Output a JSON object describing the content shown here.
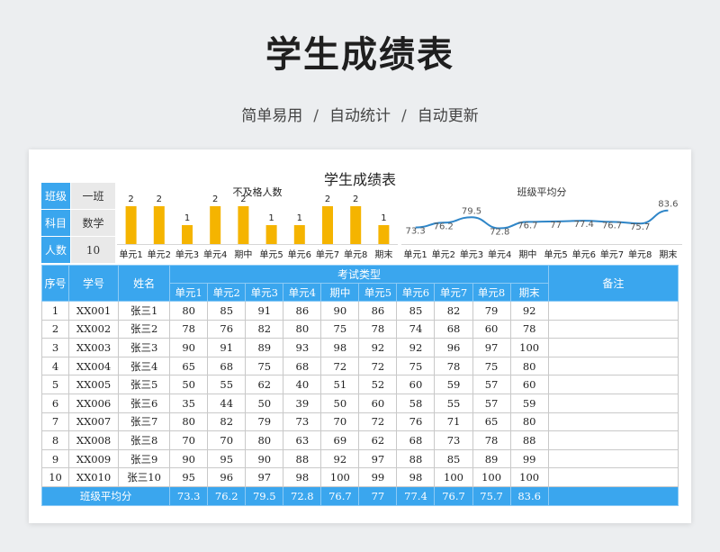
{
  "header": {
    "title": "学生成绩表",
    "subtitle_items": [
      "简单易用",
      "自动统计",
      "自动更新"
    ],
    "separator": "/"
  },
  "sheet": {
    "title": "学生成绩表",
    "info": [
      {
        "key": "班级",
        "value": "一班"
      },
      {
        "key": "科目",
        "value": "数学"
      },
      {
        "key": "人数",
        "value": "10"
      }
    ]
  },
  "chart_data": [
    {
      "type": "bar",
      "title": "不及格人数",
      "categories": [
        "单元1",
        "单元2",
        "单元3",
        "单元4",
        "期中",
        "单元5",
        "单元6",
        "单元7",
        "单元8",
        "期末"
      ],
      "values": [
        2,
        2,
        1,
        2,
        2,
        1,
        1,
        2,
        2,
        1
      ],
      "ylim": [
        0,
        2
      ],
      "color": "#f5b400"
    },
    {
      "type": "line",
      "title": "班级平均分",
      "categories": [
        "单元1",
        "单元2",
        "单元3",
        "单元4",
        "期中",
        "单元5",
        "单元6",
        "单元7",
        "单元8",
        "期末"
      ],
      "values": [
        73.3,
        76.2,
        79.5,
        72.8,
        76.7,
        77,
        77.4,
        76.7,
        75.7,
        83.6
      ],
      "color": "#2f86c8"
    }
  ],
  "table": {
    "headers": {
      "index": "序号",
      "student_id": "学号",
      "name": "姓名",
      "exam_group": "考试类型",
      "remark": "备注",
      "exams": [
        "单元1",
        "单元2",
        "单元3",
        "单元4",
        "期中",
        "单元5",
        "单元6",
        "单元7",
        "单元8",
        "期末"
      ]
    },
    "rows": [
      {
        "no": "1",
        "id": "XX001",
        "name": "张三1",
        "scores": [
          "80",
          "85",
          "91",
          "86",
          "90",
          "86",
          "85",
          "82",
          "79",
          "92"
        ],
        "remark": ""
      },
      {
        "no": "2",
        "id": "XX002",
        "name": "张三2",
        "scores": [
          "78",
          "76",
          "82",
          "80",
          "75",
          "78",
          "74",
          "68",
          "60",
          "78"
        ],
        "remark": ""
      },
      {
        "no": "3",
        "id": "XX003",
        "name": "张三3",
        "scores": [
          "90",
          "91",
          "89",
          "93",
          "98",
          "92",
          "92",
          "96",
          "97",
          "100"
        ],
        "remark": ""
      },
      {
        "no": "4",
        "id": "XX004",
        "name": "张三4",
        "scores": [
          "65",
          "68",
          "75",
          "68",
          "72",
          "72",
          "75",
          "78",
          "75",
          "80"
        ],
        "remark": ""
      },
      {
        "no": "5",
        "id": "XX005",
        "name": "张三5",
        "scores": [
          "50",
          "55",
          "62",
          "40",
          "51",
          "52",
          "60",
          "59",
          "57",
          "60"
        ],
        "remark": ""
      },
      {
        "no": "6",
        "id": "XX006",
        "name": "张三6",
        "scores": [
          "35",
          "44",
          "50",
          "39",
          "50",
          "60",
          "58",
          "55",
          "57",
          "59"
        ],
        "remark": ""
      },
      {
        "no": "7",
        "id": "XX007",
        "name": "张三7",
        "scores": [
          "80",
          "82",
          "79",
          "73",
          "70",
          "72",
          "76",
          "71",
          "65",
          "80"
        ],
        "remark": ""
      },
      {
        "no": "8",
        "id": "XX008",
        "name": "张三8",
        "scores": [
          "70",
          "70",
          "80",
          "63",
          "69",
          "62",
          "68",
          "73",
          "78",
          "88"
        ],
        "remark": ""
      },
      {
        "no": "9",
        "id": "XX009",
        "name": "张三9",
        "scores": [
          "90",
          "95",
          "90",
          "88",
          "92",
          "97",
          "88",
          "85",
          "89",
          "99"
        ],
        "remark": ""
      },
      {
        "no": "10",
        "id": "XX010",
        "name": "张三10",
        "scores": [
          "95",
          "96",
          "97",
          "98",
          "100",
          "99",
          "98",
          "100",
          "100",
          "100"
        ],
        "remark": ""
      }
    ],
    "footer": {
      "label": "班级平均分",
      "values": [
        "73.3",
        "76.2",
        "79.5",
        "72.8",
        "76.7",
        "77",
        "77.4",
        "76.7",
        "75.7",
        "83.6"
      ],
      "remark": ""
    }
  }
}
